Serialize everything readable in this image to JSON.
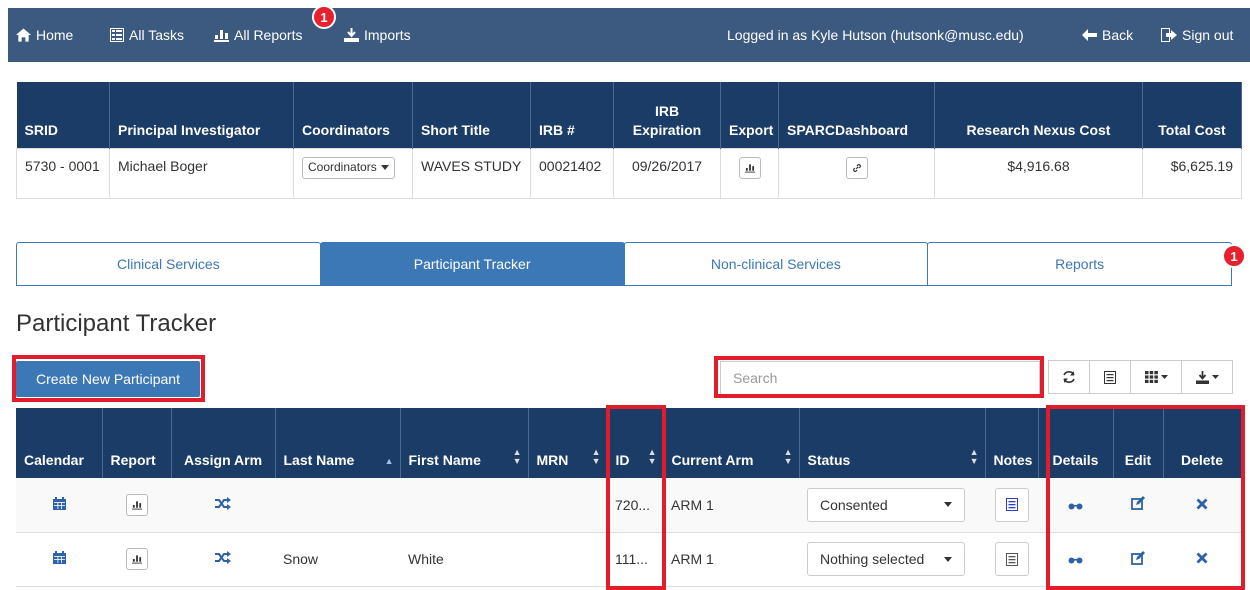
{
  "nav": {
    "home": "Home",
    "all_tasks": "All Tasks",
    "all_reports": "All Reports",
    "all_reports_badge": "1",
    "imports": "Imports",
    "logged_in": "Logged in as Kyle Hutson (hutsonk@musc.edu)",
    "back": "Back",
    "sign_out": "Sign out"
  },
  "protocol": {
    "headers": {
      "srid": "SRID",
      "pi": "Principal Investigator",
      "coordinators": "Coordinators",
      "short_title": "Short Title",
      "irb": "IRB #",
      "irb_expiration": "IRB Expiration",
      "export": "Export",
      "sparc": "SPARCDashboard",
      "rn_cost": "Research Nexus Cost",
      "total_cost": "Total Cost"
    },
    "row": {
      "srid": "5730 - 0001",
      "pi": "Michael Boger",
      "coordinators_btn": "Coordinators",
      "short_title": "WAVES STUDY",
      "irb": "00021402",
      "irb_expiration": "09/26/2017",
      "rn_cost": "$4,916.68",
      "total_cost": "$6,625.19"
    }
  },
  "tabs": {
    "clinical": "Clinical Services",
    "participant": "Participant Tracker",
    "nonclinical": "Non-clinical Services",
    "reports": "Reports",
    "reports_badge": "1"
  },
  "section_title": "Participant Tracker",
  "create_button": "Create New Participant",
  "search": {
    "placeholder": "Search"
  },
  "participants": {
    "headers": {
      "calendar": "Calendar",
      "report": "Report",
      "assign_arm": "Assign Arm",
      "last_name": "Last Name",
      "first_name": "First Name",
      "mrn": "MRN",
      "id": "ID",
      "current_arm": "Current Arm",
      "status": "Status",
      "notes": "Notes",
      "details": "Details",
      "edit": "Edit",
      "delete": "Delete"
    },
    "rows": [
      {
        "last_name": "",
        "first_name": "",
        "mrn": "",
        "id": "720...",
        "current_arm": "ARM 1",
        "status": "Consented",
        "notes_color": "#2a3ed6"
      },
      {
        "last_name": "Snow",
        "first_name": "White",
        "mrn": "",
        "id": "111...",
        "current_arm": "ARM 1",
        "status": "Nothing selected",
        "notes_color": "#555555"
      }
    ]
  },
  "colors": {
    "nav_bg": "#3c5a80",
    "header_bg": "#1a3c66",
    "primary": "#3c78b5",
    "highlight": "#e21d2b",
    "icon_blue": "#2e62a8"
  }
}
